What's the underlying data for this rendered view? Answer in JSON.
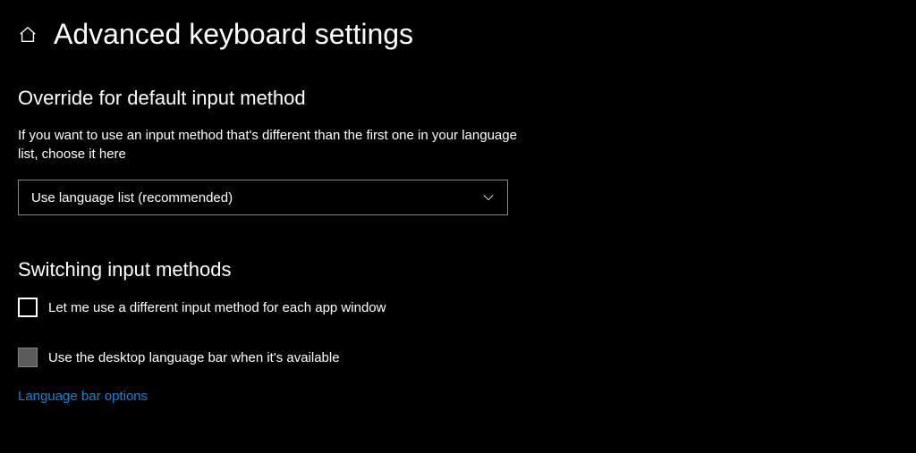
{
  "header": {
    "title": "Advanced keyboard settings"
  },
  "override": {
    "section_title": "Override for default input method",
    "description": "If you want to use an input method that's different than the first one in your language list, choose it here",
    "dropdown_value": "Use language list (recommended)"
  },
  "switching": {
    "section_title": "Switching input methods",
    "checkbox1_label": "Let me use a different input method for each app window",
    "checkbox1_checked": false,
    "checkbox2_label": "Use the desktop language bar when it's available",
    "checkbox2_checked": false
  },
  "link": {
    "language_bar_options": "Language bar options"
  }
}
